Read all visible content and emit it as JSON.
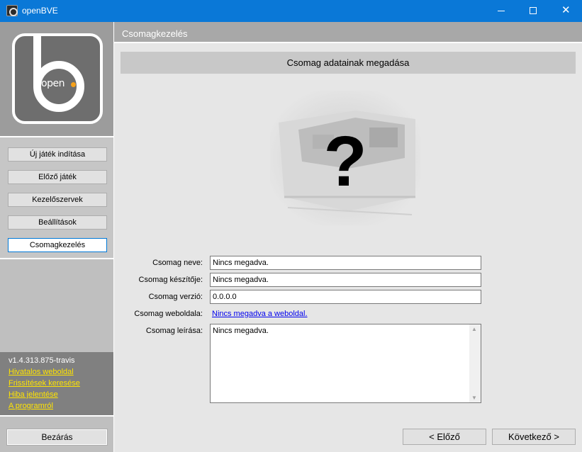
{
  "window": {
    "title": "openBVE",
    "minimize_glyph": "",
    "close_glyph": "✕"
  },
  "logo": {
    "text": "open"
  },
  "sidebar": {
    "nav": [
      {
        "label": "Új játék indítása"
      },
      {
        "label": "Előző játék"
      },
      {
        "label": "Kezelőszervek"
      },
      {
        "label": "Beállítások"
      },
      {
        "label": "Csomagkezelés",
        "active": true
      }
    ],
    "version": "v1.4.313.875-travis",
    "links": [
      {
        "label": "Hivatalos weboldal"
      },
      {
        "label": "Frissítések keresése"
      },
      {
        "label": "Hiba jelentése"
      },
      {
        "label": "A programról"
      }
    ],
    "close_label": "Bezárás"
  },
  "main": {
    "header": "Csomagkezelés",
    "subheader": "Csomag adatainak megadása",
    "illustration_mark": "?",
    "fields": {
      "name_label": "Csomag neve:",
      "name_value": "Nincs megadva.",
      "author_label": "Csomag készítője:",
      "author_value": "Nincs megadva.",
      "version_label": "Csomag verzió:",
      "version_value": "0.0.0.0",
      "website_label": "Csomag weboldala:",
      "website_value": "Nincs megadva a weboldal.",
      "description_label": "Csomag leírása:",
      "description_value": "Nincs megadva."
    },
    "prev_label": "< Előző",
    "next_label": "Következő >"
  },
  "colors": {
    "titlebar": "#0a78d7",
    "link_yellow": "#ffe400",
    "logo_accent": "#f7a21b"
  }
}
